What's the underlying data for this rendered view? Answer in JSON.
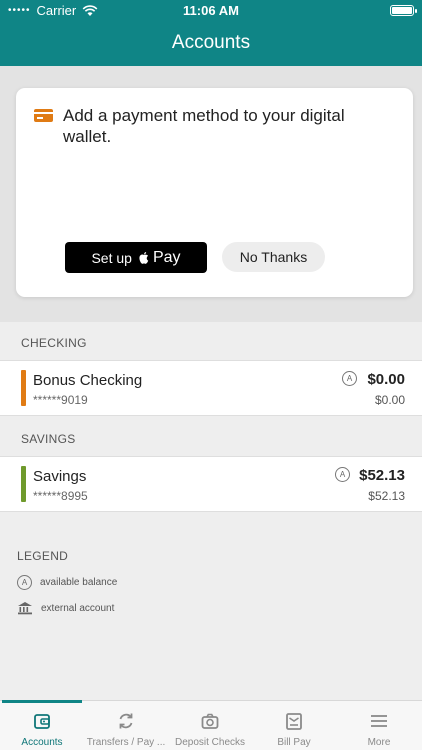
{
  "status_bar": {
    "carrier": "Carrier",
    "time": "11:06 AM",
    "signal_dots": "•••••"
  },
  "header": {
    "title": "Accounts"
  },
  "wallet_card": {
    "message": "Add a payment method to your digital wallet.",
    "setup_label": "Set up",
    "pay_label": "Pay",
    "no_thanks_label": "No Thanks"
  },
  "sections": {
    "checking": {
      "title": "CHECKING",
      "account": {
        "name": "Bonus Checking",
        "number": "******9019",
        "available_balance": "$0.00",
        "current_balance": "$0.00",
        "color": "#e07b14",
        "badge": "A"
      }
    },
    "savings": {
      "title": "SAVINGS",
      "account": {
        "name": "Savings",
        "number": "******8995",
        "available_balance": "$52.13",
        "current_balance": "$52.13",
        "color": "#6f9a2c",
        "badge": "A"
      }
    }
  },
  "legend": {
    "title": "LEGEND",
    "items": [
      {
        "icon": "available-balance-icon",
        "badge": "A",
        "label": "available balance"
      },
      {
        "icon": "bank-icon",
        "label": "external account"
      }
    ]
  },
  "tabs": [
    {
      "label": "Accounts",
      "icon": "wallet-icon",
      "active": true
    },
    {
      "label": "Transfers / Pay ...",
      "icon": "transfer-icon",
      "active": false
    },
    {
      "label": "Deposit Checks",
      "icon": "camera-icon",
      "active": false
    },
    {
      "label": "Bill Pay",
      "icon": "bill-icon",
      "active": false
    },
    {
      "label": "More",
      "icon": "menu-icon",
      "active": false
    }
  ],
  "colors": {
    "brand": "#0f8586",
    "checking_accent": "#e07b14",
    "savings_accent": "#6f9a2c"
  }
}
